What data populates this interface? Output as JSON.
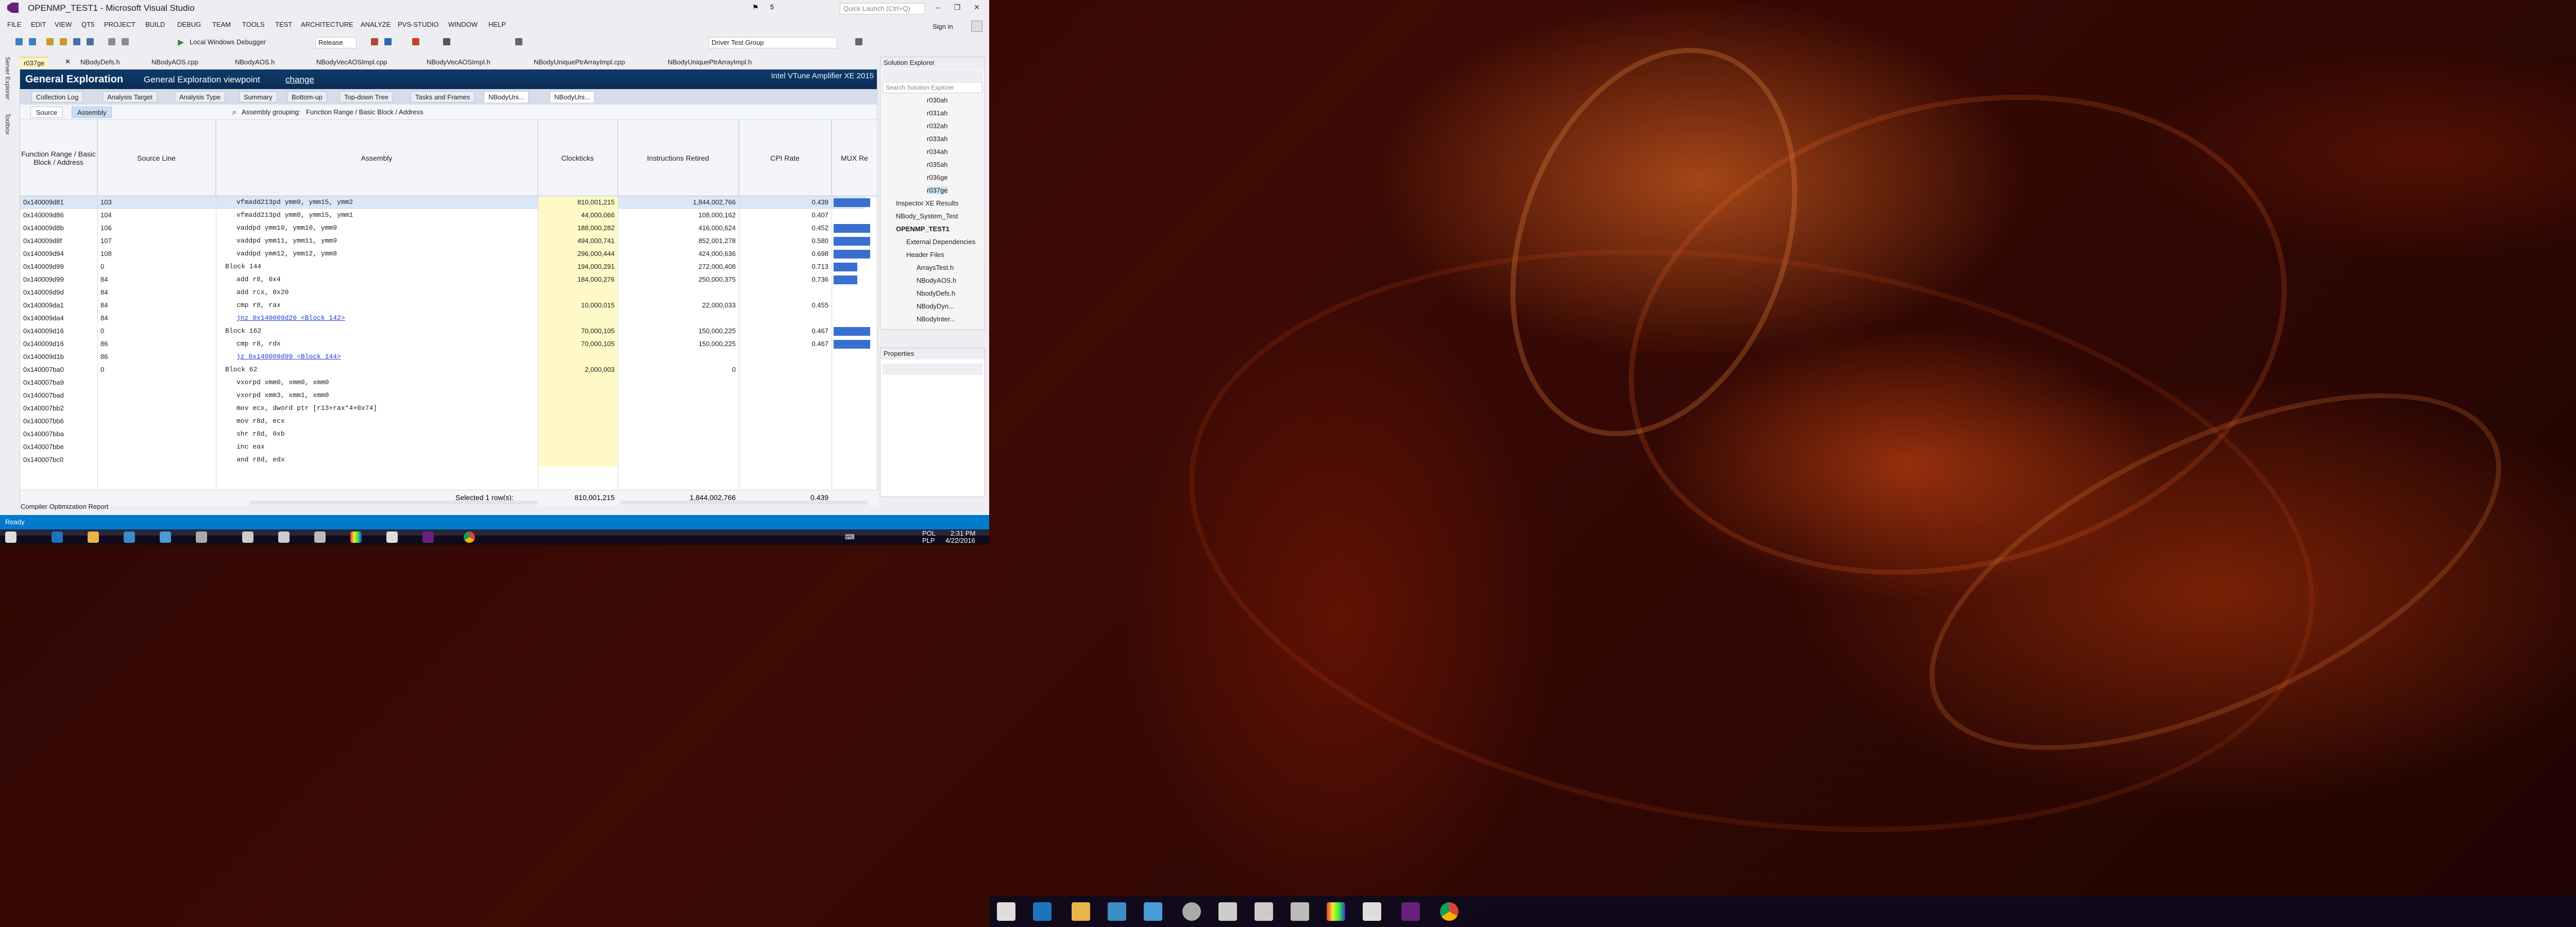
{
  "window": {
    "title": "OPENMP_TEST1 - Microsoft Visual Studio",
    "quick_launch_placeholder": "Quick Launch (Ctrl+Q)",
    "sign_in": "Sign in",
    "notification_count": "5"
  },
  "menu": [
    "FILE",
    "EDIT",
    "VIEW",
    "QT5",
    "PROJECT",
    "BUILD",
    "DEBUG",
    "TEAM",
    "TOOLS",
    "TEST",
    "ARCHITECTURE",
    "ANALYZE",
    "PVS-STUDIO",
    "WINDOW",
    "HELP"
  ],
  "toolbar": {
    "debugger": "Local Windows Debugger",
    "config": "Release",
    "group": "Driver Test Group"
  },
  "doc_tabs": [
    "r037ge",
    "NBodyDefs.h",
    "NBodyAOS.cpp",
    "NBodyAOS.h",
    "NBodyVecAOSImpl.cpp",
    "NBodyVecAOSImpl.h",
    "NBodyUniquePtrArrayImpl.cpp",
    "NBodyUniquePtrArrayImpl.h"
  ],
  "vtune": {
    "title": "General Exploration",
    "subtitle": "General Exploration viewpoint",
    "change": "change",
    "product": "Intel VTune Amplifier XE 2015",
    "tabs": [
      "Collection Log",
      "Analysis Target",
      "Analysis Type",
      "Summary",
      "Bottom-up",
      "Top-down Tree",
      "Tasks and Frames",
      "NBodyUni..."
    ],
    "source_btn": "Source",
    "assembly_btn": "Assembly",
    "grouping_label": "Assembly grouping:",
    "grouping_value": "Function Range / Basic Block / Address",
    "columns": [
      "Function Range / Basic Block / Address",
      "Source Line",
      "Assembly",
      "Clockticks",
      "Instructions Retired",
      "CPI Rate",
      "MUX Re"
    ],
    "rows": [
      {
        "addr": "0x140009d81",
        "src": "103",
        "asm": "vfmadd213pd ymm9, ymm15, ymm2",
        "clk": "810,001,215",
        "ins": "1,844,002,766",
        "cpi": "0.439",
        "mux": 0.85
      },
      {
        "addr": "0x140009d86",
        "src": "104",
        "asm": "vfmadd213pd ymm8, ymm15, ymm1",
        "clk": "44,000,066",
        "ins": "108,000,162",
        "cpi": "0.407",
        "mux": 0
      },
      {
        "addr": "0x140009d8b",
        "src": "106",
        "asm": "vaddpd ymm10, ymm10, ymm9",
        "clk": "188,000,282",
        "ins": "416,000,624",
        "cpi": "0.452",
        "mux": 0.85
      },
      {
        "addr": "0x140009d8f",
        "src": "107",
        "asm": "vaddpd ymm11, ymm11, ymm9",
        "clk": "494,000,741",
        "ins": "852,001,278",
        "cpi": "0.580",
        "mux": 0.85
      },
      {
        "addr": "0x140009d94",
        "src": "108",
        "asm": "vaddpd ymm12, ymm12, ymm8",
        "clk": "296,000,444",
        "ins": "424,000,636",
        "cpi": "0.698",
        "mux": 0.85
      },
      {
        "addr": "0x140009d99",
        "src": "0",
        "asm": "Block 144",
        "clk": "194,000,291",
        "ins": "272,000,408",
        "cpi": "0.713",
        "mux": 0.55,
        "block": true
      },
      {
        "addr": "0x140009d99",
        "src": "84",
        "asm": "add r8, 0x4",
        "clk": "184,000,276",
        "ins": "250,000,375",
        "cpi": "0.736",
        "mux": 0.55
      },
      {
        "addr": "0x140009d9d",
        "src": "84",
        "asm": "add rcx, 0x20",
        "clk": "",
        "ins": "",
        "cpi": "",
        "mux": 0
      },
      {
        "addr": "0x140009da1",
        "src": "84",
        "asm": "cmp r8, rax",
        "clk": "10,000,015",
        "ins": "22,000,033",
        "cpi": "0.455",
        "mux": 0
      },
      {
        "addr": "0x140009da4",
        "src": "84",
        "asm": "jnz 0x140009d20 <Block 142>",
        "clk": "",
        "ins": "",
        "cpi": "",
        "mux": 0,
        "link": true
      },
      {
        "addr": "0x140009d16",
        "src": "0",
        "asm": "Block 162",
        "clk": "70,000,105",
        "ins": "150,000,225",
        "cpi": "0.467",
        "mux": 0.85,
        "block": true
      },
      {
        "addr": "0x140009d16",
        "src": "86",
        "asm": "cmp r8, rdx",
        "clk": "70,000,105",
        "ins": "150,000,225",
        "cpi": "0.467",
        "mux": 0.85
      },
      {
        "addr": "0x140009d1b",
        "src": "86",
        "asm": "jz 0x140009d99 <Block 144>",
        "clk": "",
        "ins": "",
        "cpi": "",
        "mux": 0,
        "link": true
      },
      {
        "addr": "0x140007ba0",
        "src": "0",
        "asm": "Block 62",
        "clk": "2,000,003",
        "ins": "0",
        "cpi": "",
        "mux": 0,
        "block": true
      },
      {
        "addr": "0x140007ba9",
        "src": "",
        "asm": "vxorpd xmm0, xmm0, xmm0",
        "clk": "",
        "ins": "",
        "cpi": "",
        "mux": 0
      },
      {
        "addr": "0x140007bad",
        "src": "",
        "asm": "vxorpd xmm3, xmm1, xmm0",
        "clk": "",
        "ins": "",
        "cpi": "",
        "mux": 0
      },
      {
        "addr": "0x140007bb2",
        "src": "",
        "asm": "mov ecx, dword ptr [r13+rax*4+0x74]",
        "clk": "",
        "ins": "",
        "cpi": "",
        "mux": 0
      },
      {
        "addr": "0x140007bb6",
        "src": "",
        "asm": "mov r8d, ecx",
        "clk": "",
        "ins": "",
        "cpi": "",
        "mux": 0
      },
      {
        "addr": "0x140007bba",
        "src": "",
        "asm": "shr r8d, 0xb",
        "clk": "",
        "ins": "",
        "cpi": "",
        "mux": 0
      },
      {
        "addr": "0x140007bbe",
        "src": "",
        "asm": "inc eax",
        "clk": "",
        "ins": "",
        "cpi": "",
        "mux": 0
      },
      {
        "addr": "0x140007bc0",
        "src": "",
        "asm": "and r8d, edx",
        "clk": "",
        "ins": "",
        "cpi": "",
        "mux": 0
      }
    ],
    "footer": {
      "selected": "Selected 1 row(s):",
      "clk": "810,001,215",
      "ins": "1,844,002,766",
      "cpi": "0.439"
    }
  },
  "solution_explorer": {
    "title": "Solution Explorer",
    "search_placeholder": "Search Solution Explorer",
    "items": [
      "r030ah",
      "r031ah",
      "r032ah",
      "r033ah",
      "r034ah",
      "r035ah",
      "r036ge",
      "r037ge",
      "Inspector XE Results",
      "NBody_System_Test",
      "OPENMP_TEST1",
      "External Dependencies",
      "Header Files",
      "ArraysTest.h",
      "NBodyAOS.h",
      "NbodyDefs.h",
      "NBodyDyn...",
      "NBodyInter..."
    ]
  },
  "properties": {
    "title": "Properties"
  },
  "left_strip": [
    "Server Explorer",
    "Toolbox"
  ],
  "bottom_tab": "Compiler Optimization Report",
  "status": "Ready",
  "clock": {
    "lang": "POL",
    "layout": "PLP",
    "time": "2:31 PM",
    "date": "4/22/2016"
  },
  "colors": {
    "vs_accent": "#007acc",
    "vtune_header": "#0c3a6a",
    "highlight": "#fff9c8",
    "mux_bar": "#3a6fd0"
  }
}
